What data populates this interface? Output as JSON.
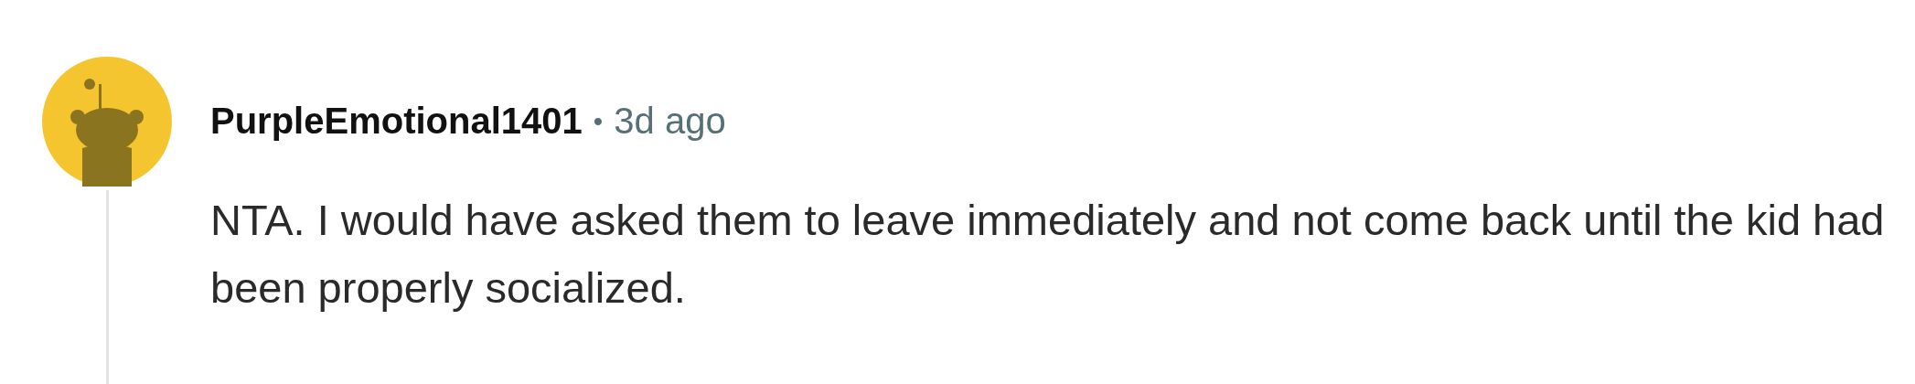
{
  "comment": {
    "author": "PurpleEmotional1401",
    "separator": "•",
    "time": "3d ago",
    "body": "NTA. I would have asked them to leave immediately and not come back until the kid had been properly socialized."
  }
}
